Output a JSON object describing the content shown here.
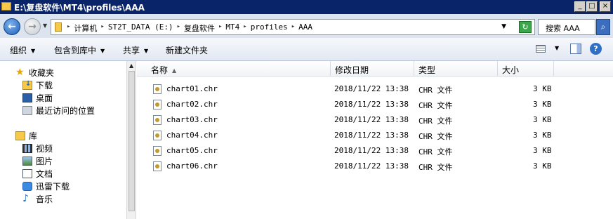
{
  "window": {
    "title": "E:\\复盘软件\\MT4\\profiles\\AAA",
    "buttons": {
      "minimize": "_",
      "maximize": "□",
      "close": "×"
    }
  },
  "address": {
    "back_icon": "back-arrow-icon",
    "forward_icon": "forward-arrow-icon",
    "crumbs": [
      "计算机",
      "ST2T_DATA (E:)",
      "复盘软件",
      "MT4",
      "profiles",
      "AAA"
    ],
    "search_placeholder": "搜索 AAA"
  },
  "toolbar": {
    "organize": "组织",
    "include_in_library": "包含到库中",
    "share": "共享",
    "new_folder": "新建文件夹"
  },
  "sidebar": {
    "favorites": {
      "label": "收藏夹",
      "items": [
        {
          "label": "下载",
          "icon": "downloads-folder-icon"
        },
        {
          "label": "桌面",
          "icon": "desktop-icon"
        },
        {
          "label": "最近访问的位置",
          "icon": "recent-places-icon"
        }
      ]
    },
    "libraries": {
      "label": "库",
      "items": [
        {
          "label": "视频",
          "icon": "videos-icon"
        },
        {
          "label": "图片",
          "icon": "pictures-icon"
        },
        {
          "label": "文档",
          "icon": "documents-icon"
        },
        {
          "label": "迅雷下载",
          "icon": "thunder-download-icon"
        },
        {
          "label": "音乐",
          "icon": "music-icon"
        }
      ]
    }
  },
  "filelist": {
    "columns": [
      "名称",
      "修改日期",
      "类型",
      "大小"
    ],
    "rows": [
      {
        "name": "chart01.chr",
        "date": "2018/11/22 13:38",
        "type": "CHR 文件",
        "size": "3 KB"
      },
      {
        "name": "chart02.chr",
        "date": "2018/11/22 13:38",
        "type": "CHR 文件",
        "size": "3 KB"
      },
      {
        "name": "chart03.chr",
        "date": "2018/11/22 13:38",
        "type": "CHR 文件",
        "size": "3 KB"
      },
      {
        "name": "chart04.chr",
        "date": "2018/11/22 13:38",
        "type": "CHR 文件",
        "size": "3 KB"
      },
      {
        "name": "chart05.chr",
        "date": "2018/11/22 13:38",
        "type": "CHR 文件",
        "size": "3 KB"
      },
      {
        "name": "chart06.chr",
        "date": "2018/11/22 13:38",
        "type": "CHR 文件",
        "size": "3 KB"
      }
    ]
  },
  "colors": {
    "titlebar": "#0a246a",
    "address_bar": "#dbe4ef",
    "toolbar": "#e2e8f2"
  }
}
